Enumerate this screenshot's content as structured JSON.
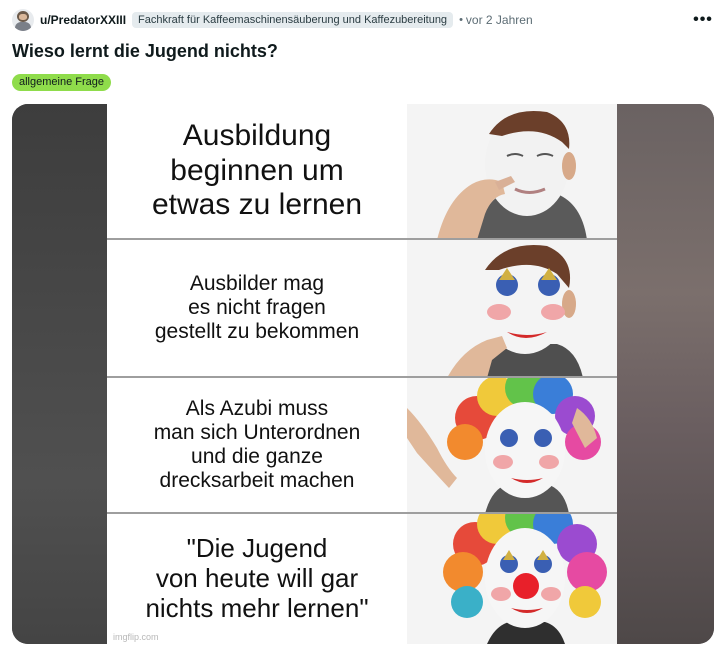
{
  "post": {
    "username": "u/PredatorXXIII",
    "user_flair": "Fachkraft für Kaffeemaschinensäuberung und Kaffezubereitung",
    "separator": "•",
    "time": "vor 2 Jahren",
    "more_label": "•••",
    "title": "Wieso lernt die Jugend nichts?",
    "post_flair": "allgemeine Frage",
    "post_flair_color": "#8fdc4b"
  },
  "meme": {
    "panels": [
      {
        "caption": "Ausbildung\nbeginnen um\netwas zu lernen"
      },
      {
        "caption": "Ausbilder mag\nes nicht fragen\ngestellt zu bekommen"
      },
      {
        "caption": "Als Azubi muss\nman sich Unterordnen\nund die ganze\ndrecksarbeit machen"
      },
      {
        "caption": "\"Die Jugend\nvon heute will gar\nnichts mehr lernen\""
      }
    ],
    "watermark": "imgflip.com"
  }
}
